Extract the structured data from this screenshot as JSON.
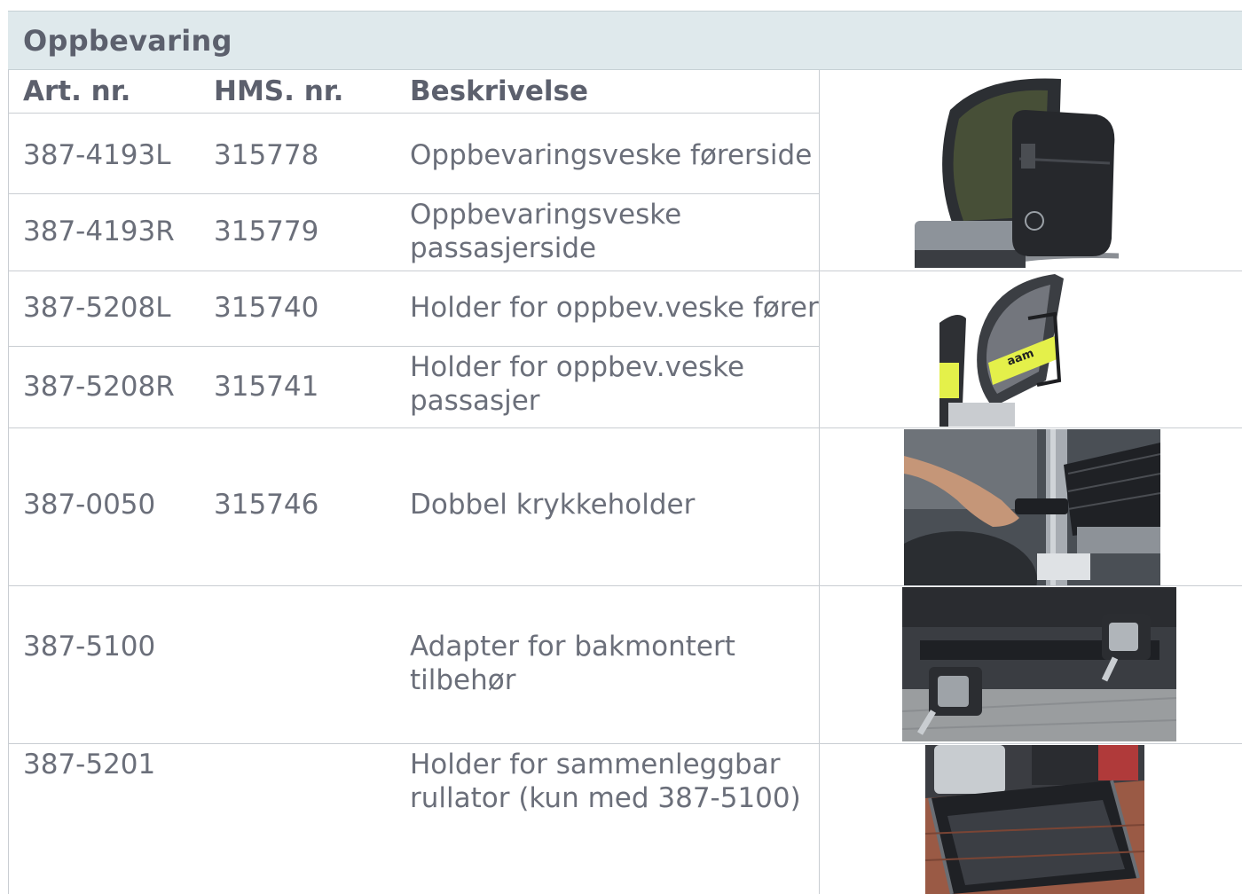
{
  "section": {
    "title": "Oppbevaring"
  },
  "columns": {
    "art": "Art. nr.",
    "hms": "HMS. nr.",
    "desc": "Beskrivelse"
  },
  "rows": [
    {
      "art": "387-4193L",
      "hms": "315778",
      "desc": "Oppbevaringsveske førerside"
    },
    {
      "art": "387-4193R",
      "hms": "315779",
      "desc": "Oppbevaringsveske passasjerside"
    },
    {
      "art": "387-5208L",
      "hms": "315740",
      "desc": "Holder for oppbev.veske fører"
    },
    {
      "art": "387-5208R",
      "hms": "315741",
      "desc": "Holder for oppbev.veske passasjer"
    },
    {
      "art": "387-0050",
      "hms": "315746",
      "desc": "Dobbel krykkeholder"
    },
    {
      "art": "387-5100",
      "hms": "",
      "desc": "Adapter for bakmontert tilbehør"
    },
    {
      "art": "387-5201",
      "hms": "",
      "desc": "Holder for sammenleggbar rullator (kun med 387-5100)"
    }
  ],
  "images": [
    {
      "name": "storage-bag-on-seat-photo"
    },
    {
      "name": "bag-holder-on-seat-photo",
      "label": "aam"
    },
    {
      "name": "crutch-holder-photo"
    },
    {
      "name": "rear-adapter-photo"
    },
    {
      "name": "rollator-holder-photo"
    }
  ],
  "colors": {
    "header_bar": "#dfe9ec",
    "text": "#6b6f7a",
    "heading_text": "#5c606d",
    "grid": "#c9cdd2",
    "accent_yellow": "#e4f04a"
  }
}
